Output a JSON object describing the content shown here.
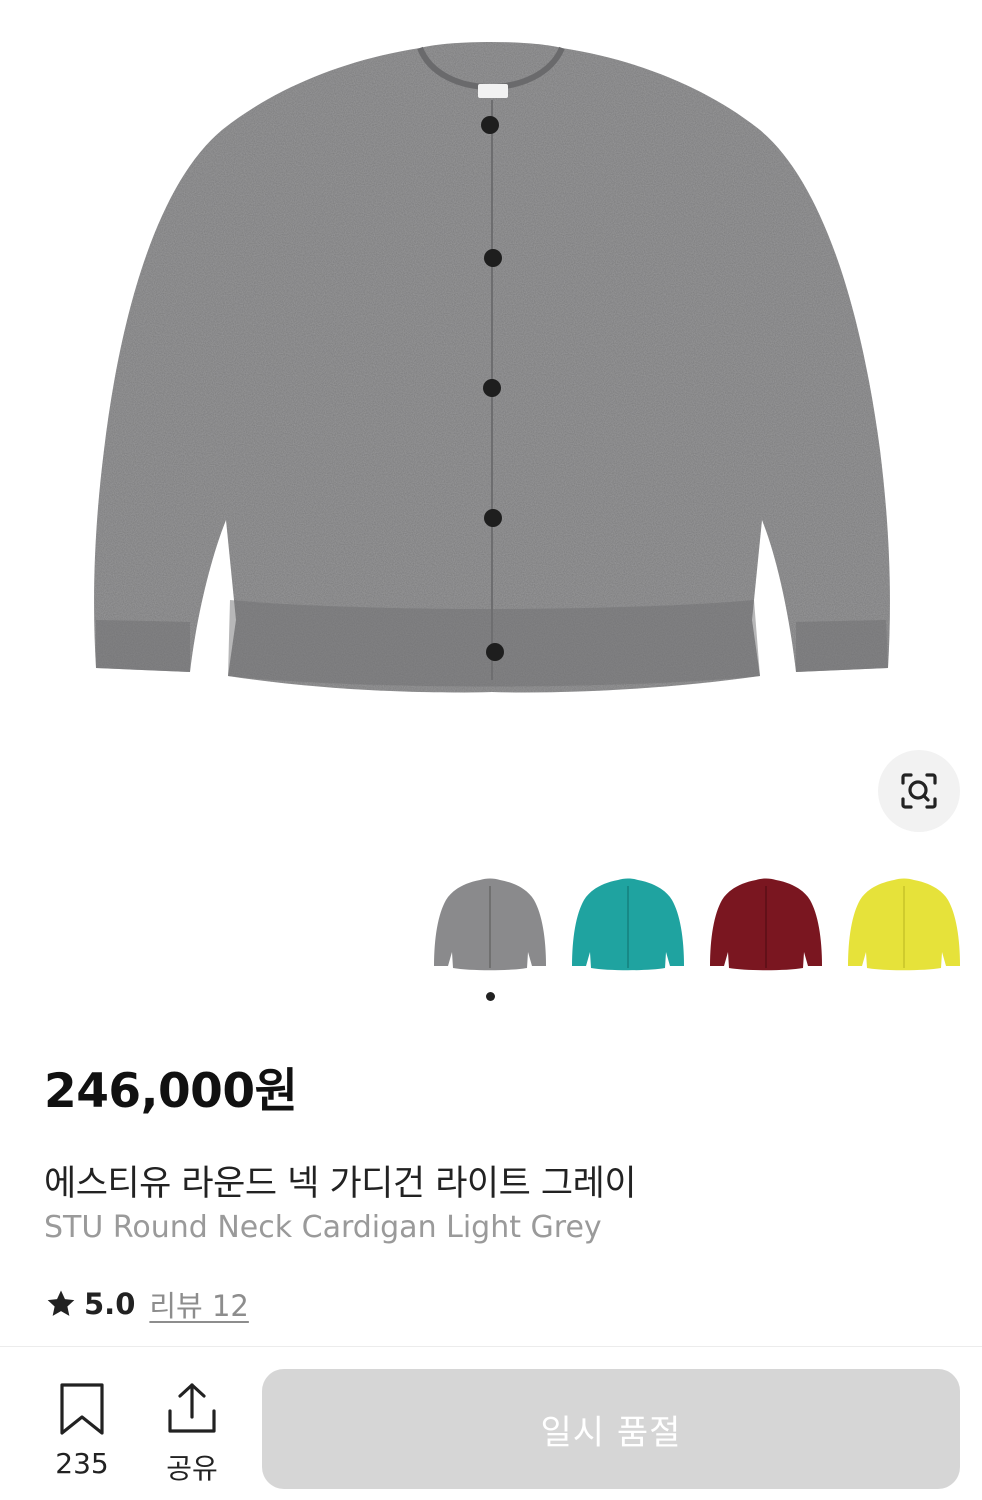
{
  "product": {
    "price": "246,000원",
    "name_ko": "에스티유 라운드 넥 가디건 라이트 그레이",
    "name_en": "STU Round Neck Cardigan Light Grey",
    "rating": "5.0",
    "reviews": "리뷰 12"
  },
  "colors": {
    "main_knit": "#7b7b7d",
    "options": [
      {
        "color": "#8a8a8c"
      },
      {
        "color": "#1fa3a0"
      },
      {
        "color": "#7a1620"
      },
      {
        "color": "#e6e23a"
      }
    ],
    "selected_index": 0
  },
  "actions": {
    "bookmark_count": "235",
    "share_label": "공유",
    "soldout_label": "일시 품절"
  },
  "icons": {
    "lens": "visual-search-icon",
    "star": "star-icon",
    "bookmark": "bookmark-icon",
    "share": "share-icon"
  }
}
